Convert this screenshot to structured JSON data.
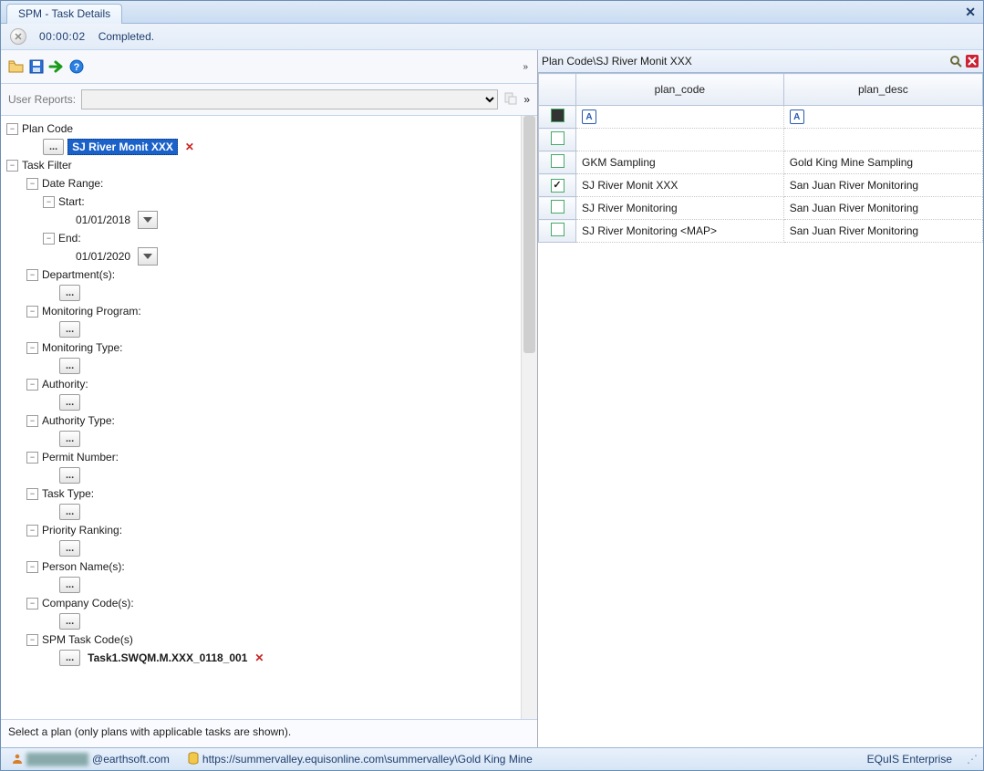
{
  "tab": {
    "title": "SPM - Task Details"
  },
  "status": {
    "time": "00:00:02",
    "msg": "Completed."
  },
  "toolbar": {
    "ellipsis": "..."
  },
  "reportRow": {
    "label": "User Reports:"
  },
  "tree": {
    "planCode": {
      "label": "Plan Code",
      "value": "SJ River Monit XXX"
    },
    "taskFilter": {
      "label": "Task Filter"
    },
    "dateRange": {
      "label": "Date Range:",
      "start": {
        "label": "Start:",
        "value": "01/01/2018"
      },
      "end": {
        "label": "End:",
        "value": "01/01/2020"
      }
    },
    "departments": {
      "label": "Department(s):"
    },
    "monitoringProgram": {
      "label": "Monitoring Program:"
    },
    "monitoringType": {
      "label": "Monitoring Type:"
    },
    "authority": {
      "label": "Authority:"
    },
    "authorityType": {
      "label": "Authority Type:"
    },
    "permitNumber": {
      "label": "Permit Number:"
    },
    "taskType": {
      "label": "Task Type:"
    },
    "priorityRanking": {
      "label": "Priority Ranking:"
    },
    "personNames": {
      "label": "Person Name(s):"
    },
    "companyCodes": {
      "label": "Company Code(s):"
    },
    "spmTaskCodes": {
      "label": "SPM Task Code(s)",
      "value": "Task1.SWQM.M.XXX_0118_001"
    }
  },
  "hint": "Select a plan (only plans with applicable tasks are shown).",
  "rightPanel": {
    "title": "Plan Code\\SJ River Monit XXX",
    "cols": {
      "c1": "plan_code",
      "c2": "plan_desc"
    },
    "filterGlyph": "A",
    "rows": [
      {
        "checked": false,
        "code": "GKM Sampling",
        "desc": "Gold King Mine Sampling"
      },
      {
        "checked": true,
        "code": "SJ River Monit XXX",
        "desc": "San Juan River Monitoring"
      },
      {
        "checked": false,
        "code": "SJ River Monitoring",
        "desc": "San Juan River Monitoring"
      },
      {
        "checked": false,
        "code": "SJ River Monitoring <MAP>",
        "desc": "San Juan River Monitoring"
      }
    ]
  },
  "footer": {
    "userSuffix": "@earthsoft.com",
    "url": "https://summervalley.equisonline.com\\summervalley\\Gold King Mine",
    "product": "EQuIS Enterprise"
  }
}
